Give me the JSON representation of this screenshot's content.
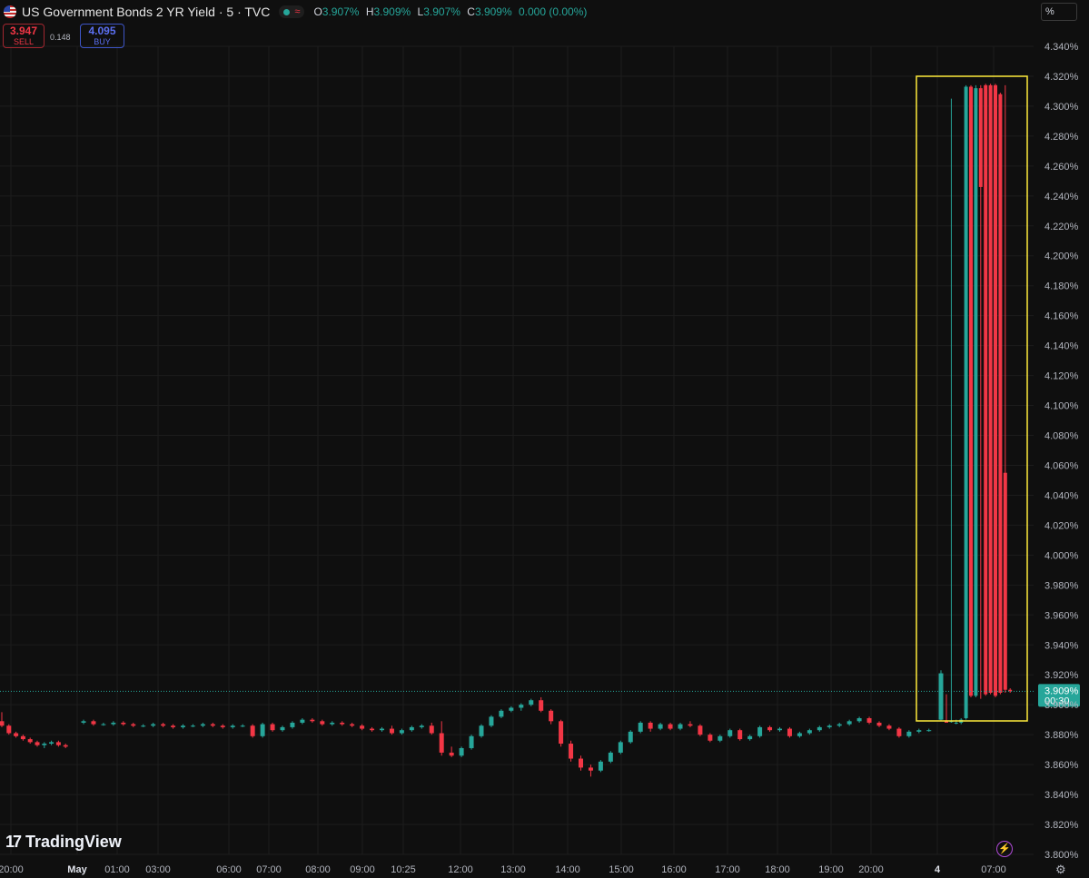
{
  "header": {
    "title": "US Government Bonds 2 YR Yield · 5 · TVC",
    "ohlc": [
      {
        "k": "O",
        "v": "3.907%"
      },
      {
        "k": "H",
        "v": "3.909%"
      },
      {
        "k": "L",
        "v": "3.907%"
      },
      {
        "k": "C",
        "v": "3.909%"
      }
    ],
    "change": "0.000 (0.00%)",
    "wave_icon": "≈"
  },
  "trade": {
    "sell_price": "3.947",
    "sell_label": "SELL",
    "spread": "0.148",
    "buy_price": "4.095",
    "buy_label": "BUY"
  },
  "scale_button": "%",
  "branding": {
    "logo_mark": "17",
    "name": "TradingView"
  },
  "colors": {
    "up": "#26a69a",
    "down": "#f23645",
    "highlight": "#ffeb3b",
    "background": "#0f0f0f",
    "grid": "#1c1c1c"
  },
  "chart_data": {
    "type": "candlestick",
    "y_unit": "%",
    "ylim": [
      3.8,
      4.34
    ],
    "y_ticks": [
      "4.340%",
      "4.320%",
      "4.300%",
      "4.280%",
      "4.260%",
      "4.240%",
      "4.220%",
      "4.200%",
      "4.180%",
      "4.160%",
      "4.140%",
      "4.120%",
      "4.100%",
      "4.080%",
      "4.060%",
      "4.040%",
      "4.020%",
      "4.000%",
      "3.980%",
      "3.960%",
      "3.940%",
      "3.920%",
      "3.900%",
      "3.880%",
      "3.860%",
      "3.840%",
      "3.820%",
      "3.800%"
    ],
    "x_ticks": [
      "20:00",
      "May",
      "01:00",
      "03:00",
      "06:00",
      "07:00",
      "08:00",
      "09:00",
      "10:25",
      "12:00",
      "13:00",
      "14:00",
      "15:00",
      "16:00",
      "17:00",
      "18:00",
      "19:00",
      "20:00",
      "4",
      "07:00"
    ],
    "bold_x_ticks": [
      "May",
      "4"
    ],
    "last_price": "3.909%",
    "countdown": "00:30",
    "last_value": 3.909,
    "candles": [
      [
        3.889,
        3.895,
        3.885,
        3.886
      ],
      [
        3.886,
        3.887,
        3.88,
        3.881
      ],
      [
        3.881,
        3.882,
        3.878,
        3.879
      ],
      [
        3.879,
        3.88,
        3.876,
        3.877
      ],
      [
        3.877,
        3.878,
        3.874,
        3.875
      ],
      [
        3.875,
        3.876,
        3.872,
        3.873
      ],
      [
        3.873,
        3.875,
        3.871,
        3.874
      ],
      [
        3.874,
        3.876,
        3.873,
        3.875
      ],
      [
        3.875,
        3.876,
        3.872,
        3.873
      ],
      [
        3.873,
        3.874,
        3.871,
        3.872
      ],
      [
        3.888,
        3.89,
        3.887,
        3.889
      ],
      [
        3.889,
        3.89,
        3.886,
        3.887
      ],
      [
        3.887,
        3.888,
        3.886,
        3.887
      ],
      [
        3.887,
        3.889,
        3.886,
        3.888
      ],
      [
        3.888,
        3.889,
        3.886,
        3.887
      ],
      [
        3.887,
        3.888,
        3.885,
        3.886
      ],
      [
        3.886,
        3.887,
        3.885,
        3.886
      ],
      [
        3.886,
        3.888,
        3.885,
        3.887
      ],
      [
        3.887,
        3.888,
        3.885,
        3.886
      ],
      [
        3.886,
        3.887,
        3.884,
        3.885
      ],
      [
        3.885,
        3.887,
        3.884,
        3.886
      ],
      [
        3.886,
        3.887,
        3.885,
        3.886
      ],
      [
        3.886,
        3.888,
        3.885,
        3.887
      ],
      [
        3.887,
        3.888,
        3.885,
        3.886
      ],
      [
        3.886,
        3.887,
        3.884,
        3.885
      ],
      [
        3.885,
        3.887,
        3.884,
        3.886
      ],
      [
        3.886,
        3.887,
        3.885,
        3.886
      ],
      [
        3.886,
        3.887,
        3.878,
        3.879
      ],
      [
        3.879,
        3.888,
        3.878,
        3.887
      ],
      [
        3.887,
        3.888,
        3.882,
        3.883
      ],
      [
        3.883,
        3.886,
        3.882,
        3.885
      ],
      [
        3.885,
        3.889,
        3.884,
        3.888
      ],
      [
        3.888,
        3.891,
        3.887,
        3.89
      ],
      [
        3.89,
        3.891,
        3.888,
        3.889
      ],
      [
        3.889,
        3.89,
        3.886,
        3.887
      ],
      [
        3.887,
        3.889,
        3.886,
        3.888
      ],
      [
        3.888,
        3.889,
        3.886,
        3.887
      ],
      [
        3.887,
        3.888,
        3.885,
        3.886
      ],
      [
        3.886,
        3.887,
        3.883,
        3.884
      ],
      [
        3.884,
        3.885,
        3.882,
        3.883
      ],
      [
        3.883,
        3.885,
        3.882,
        3.884
      ],
      [
        3.884,
        3.886,
        3.88,
        3.881
      ],
      [
        3.881,
        3.884,
        3.88,
        3.883
      ],
      [
        3.883,
        3.886,
        3.882,
        3.885
      ],
      [
        3.885,
        3.887,
        3.884,
        3.886
      ],
      [
        3.886,
        3.888,
        3.88,
        3.881
      ],
      [
        3.881,
        3.889,
        3.866,
        3.868
      ],
      [
        3.868,
        3.872,
        3.865,
        3.866
      ],
      [
        3.866,
        3.872,
        3.865,
        3.871
      ],
      [
        3.871,
        3.88,
        3.87,
        3.879
      ],
      [
        3.879,
        3.887,
        3.878,
        3.886
      ],
      [
        3.886,
        3.893,
        3.885,
        3.892
      ],
      [
        3.892,
        3.897,
        3.891,
        3.896
      ],
      [
        3.896,
        3.899,
        3.895,
        3.898
      ],
      [
        3.898,
        3.901,
        3.896,
        3.9
      ],
      [
        3.9,
        3.904,
        3.899,
        3.903
      ],
      [
        3.903,
        3.905,
        3.895,
        3.896
      ],
      [
        3.896,
        3.897,
        3.887,
        3.889
      ],
      [
        3.889,
        3.89,
        3.872,
        3.874
      ],
      [
        3.874,
        3.876,
        3.862,
        3.864
      ],
      [
        3.864,
        3.866,
        3.856,
        3.858
      ],
      [
        3.858,
        3.86,
        3.852,
        3.856
      ],
      [
        3.856,
        3.863,
        3.855,
        3.862
      ],
      [
        3.862,
        3.869,
        3.861,
        3.868
      ],
      [
        3.868,
        3.876,
        3.867,
        3.875
      ],
      [
        3.875,
        3.883,
        3.874,
        3.882
      ],
      [
        3.882,
        3.889,
        3.881,
        3.888
      ],
      [
        3.888,
        3.889,
        3.882,
        3.884
      ],
      [
        3.884,
        3.888,
        3.883,
        3.887
      ],
      [
        3.887,
        3.888,
        3.883,
        3.884
      ],
      [
        3.884,
        3.888,
        3.883,
        3.887
      ],
      [
        3.887,
        3.889,
        3.885,
        3.886
      ],
      [
        3.886,
        3.887,
        3.879,
        3.88
      ],
      [
        3.88,
        3.881,
        3.875,
        3.876
      ],
      [
        3.876,
        3.88,
        3.875,
        3.879
      ],
      [
        3.879,
        3.884,
        3.878,
        3.883
      ],
      [
        3.883,
        3.884,
        3.876,
        3.877
      ],
      [
        3.877,
        3.88,
        3.876,
        3.879
      ],
      [
        3.879,
        3.886,
        3.878,
        3.885
      ],
      [
        3.885,
        3.886,
        3.882,
        3.883
      ],
      [
        3.883,
        3.885,
        3.882,
        3.884
      ],
      [
        3.884,
        3.885,
        3.878,
        3.879
      ],
      [
        3.879,
        3.882,
        3.878,
        3.881
      ],
      [
        3.881,
        3.884,
        3.88,
        3.883
      ],
      [
        3.883,
        3.886,
        3.882,
        3.885
      ],
      [
        3.885,
        3.887,
        3.884,
        3.886
      ],
      [
        3.886,
        3.888,
        3.885,
        3.887
      ],
      [
        3.887,
        3.89,
        3.886,
        3.889
      ],
      [
        3.889,
        3.892,
        3.888,
        3.891
      ],
      [
        3.891,
        3.892,
        3.887,
        3.888
      ],
      [
        3.888,
        3.889,
        3.885,
        3.886
      ],
      [
        3.886,
        3.887,
        3.883,
        3.884
      ],
      [
        3.884,
        3.885,
        3.878,
        3.879
      ],
      [
        3.879,
        3.883,
        3.878,
        3.882
      ],
      [
        3.882,
        3.884,
        3.881,
        3.883
      ],
      [
        3.883,
        3.884,
        3.882,
        3.883
      ],
      [
        3.89,
        3.923,
        3.889,
        3.921
      ],
      [
        3.889,
        3.907,
        3.888,
        3.888
      ],
      [
        3.889,
        4.305,
        3.888,
        3.889
      ],
      [
        3.888,
        3.89,
        3.887,
        3.888
      ],
      [
        3.888,
        3.891,
        3.887,
        3.89
      ],
      [
        3.891,
        4.314,
        3.89,
        4.313
      ],
      [
        4.313,
        4.314,
        3.905,
        3.906
      ],
      [
        3.906,
        4.314,
        3.905,
        4.312
      ],
      [
        4.312,
        4.314,
        3.904,
        4.246
      ],
      [
        4.314,
        4.315,
        3.906,
        3.907
      ],
      [
        4.314,
        4.315,
        3.907,
        3.908
      ],
      [
        4.314,
        4.315,
        3.905,
        3.906
      ],
      [
        4.308,
        4.309,
        3.907,
        3.908
      ],
      [
        4.055,
        4.314,
        3.908,
        3.91
      ],
      [
        3.91,
        3.911,
        3.908,
        3.909
      ]
    ]
  }
}
